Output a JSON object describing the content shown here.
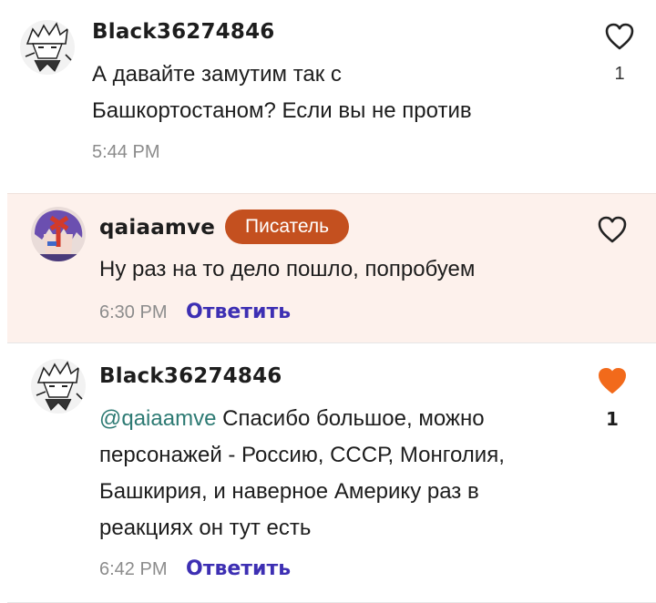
{
  "comments": [
    {
      "username": "Black36274846",
      "text": "А давайте замутим так с Башкортостаном? Если вы не против",
      "time": "5:44 PM",
      "likes": "1",
      "liked": false
    },
    {
      "username": "qaiaamve",
      "badge": "Писатель",
      "text": "Ну раз на то дело пошло, попробуем",
      "time": "6:30 PM",
      "reply_label": "Ответить",
      "liked": false
    },
    {
      "username": "Black36274846",
      "mention": "@qaiaamve",
      "text": "Спасибо большое, можно персонажей - Россию, СССР, Монголия, Башкирия, и наверное Америку раз в реакциях он тут есть",
      "time": "6:42 PM",
      "reply_label": "Ответить",
      "likes": "1",
      "liked": true
    }
  ],
  "colors": {
    "author_highlight_bg": "#fdf1ec",
    "badge_bg": "#c4501f",
    "reply_link": "#3d2fb3",
    "mention": "#2d7a73",
    "liked_heart": "#f26a1b",
    "timestamp": "#8c8c8c"
  },
  "icons": {
    "like_empty": "heart-outline-icon",
    "like_filled": "heart-filled-icon"
  }
}
